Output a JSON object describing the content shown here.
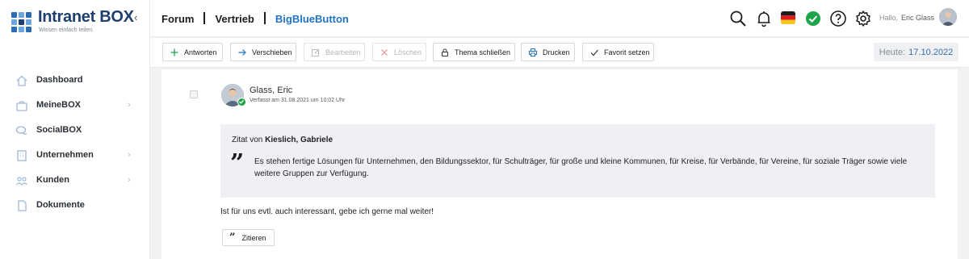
{
  "app": {
    "logo_title": "Intranet BOX",
    "logo_subtitle": "Wissen einfach teilen."
  },
  "sidebar": {
    "items": [
      {
        "label": "Dashboard",
        "icon": "home-icon",
        "chevron": false
      },
      {
        "label": "MeineBOX",
        "icon": "briefcase-icon",
        "chevron": true
      },
      {
        "label": "SocialBOX",
        "icon": "chat-icon",
        "chevron": false
      },
      {
        "label": "Unternehmen",
        "icon": "building-icon",
        "chevron": true
      },
      {
        "label": "Kunden",
        "icon": "users-icon",
        "chevron": true
      },
      {
        "label": "Dokumente",
        "icon": "document-icon",
        "chevron": false
      }
    ]
  },
  "breadcrumb": {
    "items": [
      "Forum",
      "Vertrieb",
      "BigBlueButton"
    ]
  },
  "header": {
    "greeting": "Hallo,",
    "user_name": "Eric Glass",
    "icons": [
      "search-icon",
      "bell-icon",
      "german-flag-icon",
      "status-check-icon",
      "help-icon",
      "gear-icon"
    ]
  },
  "toolbar": {
    "buttons": [
      {
        "label": "Antworten",
        "icon": "plus-icon",
        "enabled": true
      },
      {
        "label": "Verschieben",
        "icon": "arrow-right-icon",
        "enabled": true
      },
      {
        "label": "Bearbeiten",
        "icon": "edit-icon",
        "enabled": false
      },
      {
        "label": "Löschen",
        "icon": "close-icon",
        "enabled": false
      },
      {
        "label": "Thema schließen",
        "icon": "lock-icon",
        "enabled": true
      },
      {
        "label": "Drucken",
        "icon": "printer-icon",
        "enabled": true
      },
      {
        "label": "Favorit setzen",
        "icon": "checkmark-icon",
        "enabled": true
      }
    ],
    "today_label": "Heute:",
    "today_date": "17.10.2022"
  },
  "post": {
    "author": "Glass, Eric",
    "meta": "Verfasst am 31.08.2021 um 10:02 Uhr",
    "quote_prefix": "Zitat von",
    "quote_author": "Kieslich, Gabriele",
    "quote_text": "Es stehen fertige Lösungen für Unternehmen, den Bildungssektor, für Schulträger, für große und kleine Kommunen, für Kreise, für Verbände, für Vereine, für soziale Träger sowie viele weitere Gruppen zur Verfügung.",
    "body": "Ist für uns evtl. auch interessant, gebe ich gerne mal weiter!",
    "cite_label": "Zitieren"
  },
  "colors": {
    "brand": "#1f3f6f",
    "accent": "#1f74c4",
    "online": "#1ea44a"
  }
}
